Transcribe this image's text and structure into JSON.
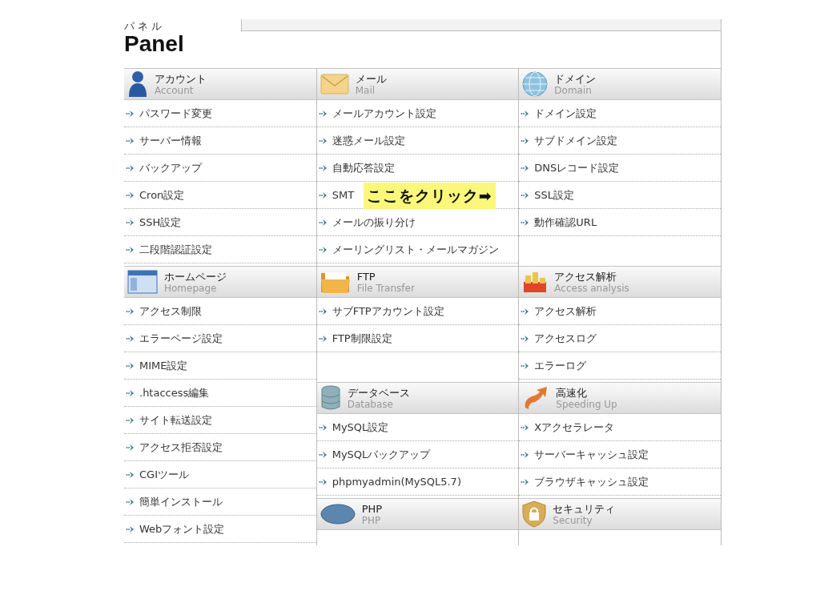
{
  "logo": {
    "ruby": "パネル",
    "title": "Panel"
  },
  "columns": [
    {
      "sections": [
        {
          "title": "アカウント",
          "subtitle": "Account",
          "items": [
            "パスワード変更",
            "サーバー情報",
            "バックアップ",
            "Cron設定",
            "SSH設定",
            "二段階認証設定"
          ]
        },
        {
          "title": "ホームページ",
          "subtitle": "Homepage",
          "items": [
            "アクセス制限",
            "エラーページ設定",
            "MIME設定",
            ".htaccess編集",
            "サイト転送設定",
            "アクセス拒否設定",
            "CGIツール",
            "簡単インストール",
            "Webフォント設定"
          ]
        }
      ]
    },
    {
      "sections": [
        {
          "title": "メール",
          "subtitle": "Mail",
          "items": [
            "メールアカウント設定",
            "迷惑メール設定",
            "自動応答設定",
            "SMT",
            "メールの振り分け",
            "メーリングリスト・メールマガジン"
          ]
        },
        {
          "title": "FTP",
          "subtitle": "File Transfer",
          "items": [
            "サブFTPアカウント設定",
            "FTP制限設定"
          ]
        },
        {
          "title": "データベース",
          "subtitle": "Database",
          "items": [
            "MySQL設定",
            "MySQLバックアップ",
            "phpmyadmin(MySQL5.7)"
          ]
        },
        {
          "title": "PHP",
          "subtitle": "PHP"
        }
      ]
    },
    {
      "sections": [
        {
          "title": "ドメイン",
          "subtitle": "Domain",
          "items": [
            "ドメイン設定",
            "サブドメイン設定",
            "DNSレコード設定",
            "SSL設定",
            "動作確認URL"
          ]
        },
        {
          "title": "アクセス解析",
          "subtitle": "Access analysis",
          "items": [
            "アクセス解析",
            "アクセスログ",
            "エラーログ"
          ]
        },
        {
          "title": "高速化",
          "subtitle": "Speeding Up",
          "items": [
            "Xアクセラレータ",
            "サーバーキャッシュ設定",
            "ブラウザキャッシュ設定"
          ]
        },
        {
          "title": "セキュリティ",
          "subtitle": "Security"
        }
      ]
    }
  ],
  "callout": "ここをクリック➡"
}
